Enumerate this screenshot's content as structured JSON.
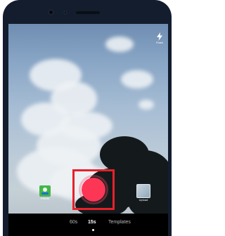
{
  "top_controls": {
    "flash_label": "Flash"
  },
  "side": {
    "effects_label": "Effects",
    "upload_label": "Upload"
  },
  "modes": {
    "items": [
      {
        "label": "60s"
      },
      {
        "label": "15s"
      },
      {
        "label": "Templates"
      }
    ]
  },
  "colors": {
    "record": "#fd3656",
    "highlight": "#e8202a",
    "active_mode": "#ffffff",
    "inactive_mode": "#b9b9b9"
  },
  "icons": {
    "flash": "flash-icon",
    "effects": "effects-icon",
    "upload": "upload-thumbnail-icon"
  },
  "state": {
    "selected_mode": "15s"
  }
}
